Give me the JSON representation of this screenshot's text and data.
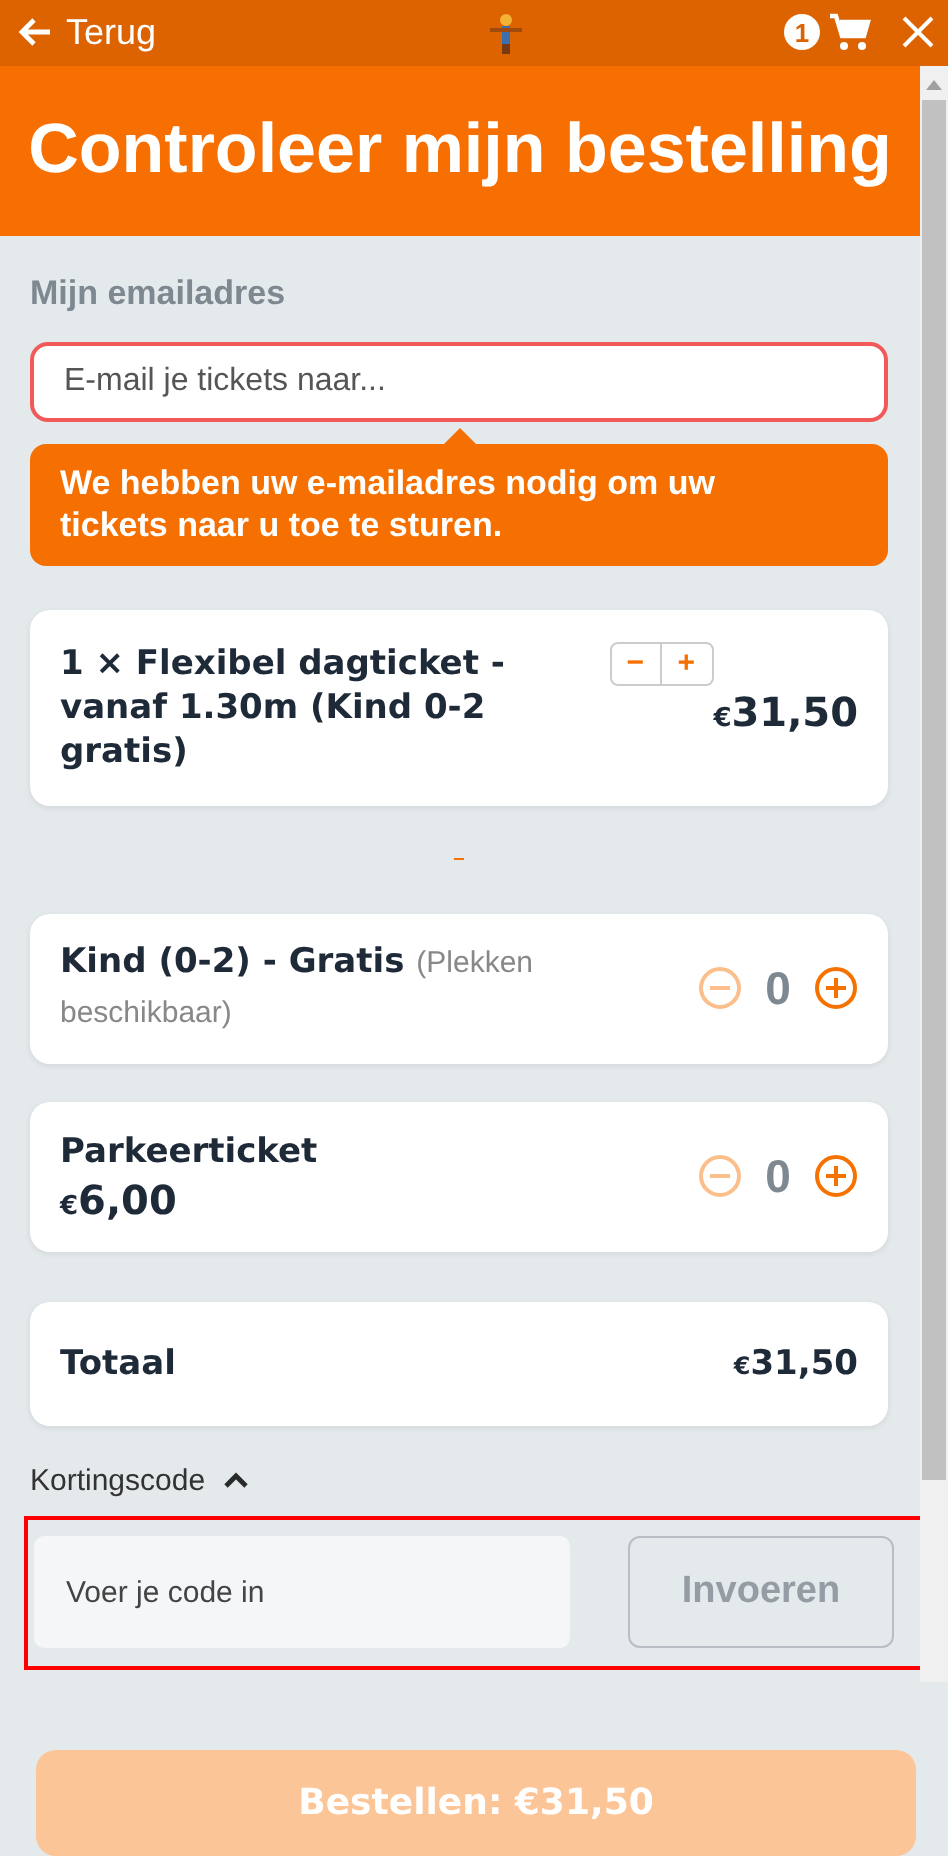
{
  "top_bar": {
    "back_label": "Terug",
    "cart_count": "1"
  },
  "header": {
    "title": "Controleer mijn bestelling"
  },
  "email": {
    "label": "Mijn emailadres",
    "placeholder": "E-mail je tickets naar...",
    "invalid": true,
    "tooltip": "We hebben uw e-mailadres nodig om uw tickets naar u toe te sturen."
  },
  "tickets": [
    {
      "kind": "stepper",
      "title": "1 × Flexibel dagticket - vanaf 1.30m (Kind 0-2 gratis)",
      "minus": "−",
      "plus": "+",
      "price": "31,50",
      "currency": "€"
    },
    {
      "kind": "counter",
      "title": "Kind (0-2) - Gratis",
      "note": "(Plekken beschikbaar)",
      "count": "0",
      "minus_disabled": true
    },
    {
      "kind": "counter",
      "title": "Parkeerticket",
      "price": "6,00",
      "currency": "€",
      "count": "0",
      "minus_disabled": true
    }
  ],
  "total": {
    "label": "Totaal",
    "currency": "€",
    "amount": "31,50"
  },
  "discount": {
    "label": "Kortingscode",
    "expanded": true,
    "placeholder": "Voer je code in",
    "button": "Invoeren",
    "button_disabled": true
  },
  "order_button": {
    "label": "Bestellen: €31,50",
    "disabled": true
  }
}
